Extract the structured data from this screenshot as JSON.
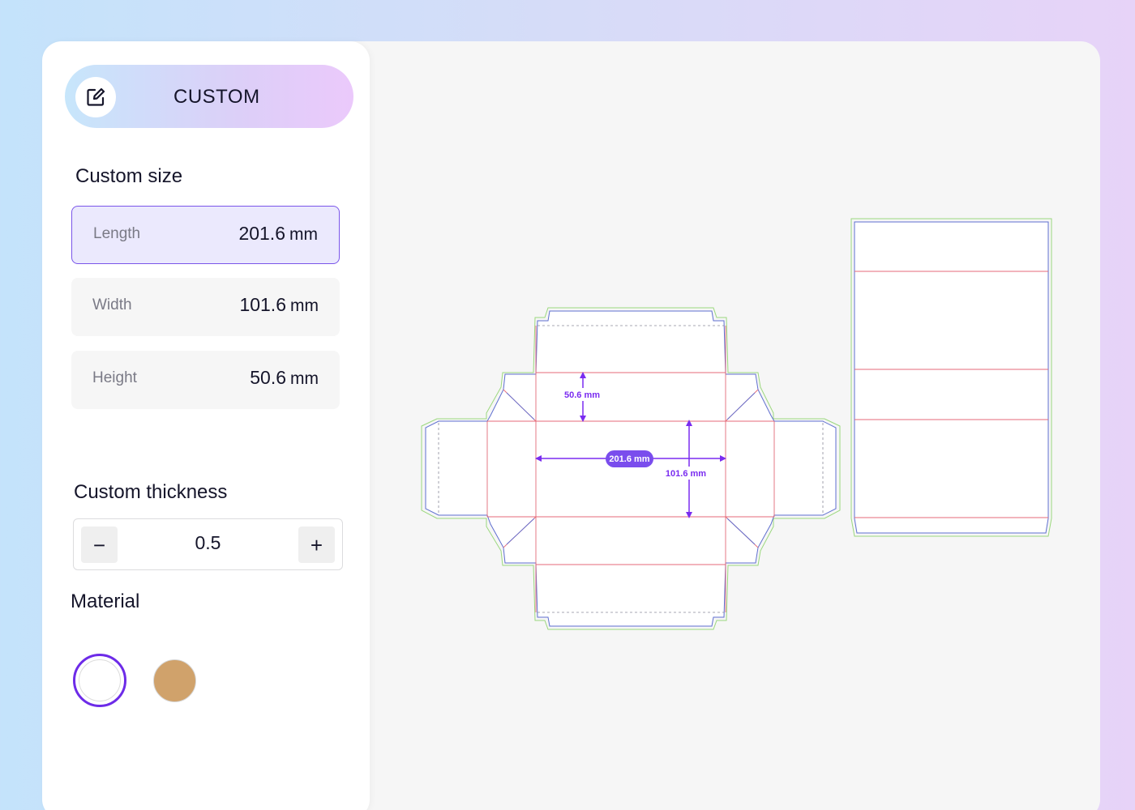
{
  "mode": {
    "label": "CUSTOM",
    "icon": "edit-icon"
  },
  "custom_size": {
    "title": "Custom size",
    "fields": [
      {
        "label": "Length",
        "value": "201.6",
        "unit": "mm",
        "active": true
      },
      {
        "label": "Width",
        "value": "101.6",
        "unit": "mm",
        "active": false
      },
      {
        "label": "Height",
        "value": "50.6",
        "unit": "mm",
        "active": false
      }
    ]
  },
  "custom_thickness": {
    "title": "Custom thickness",
    "value": "0.5",
    "decrement_label": "−",
    "increment_label": "+"
  },
  "material": {
    "title": "Material",
    "options": [
      {
        "name": "white",
        "color": "#ffffff",
        "selected": true
      },
      {
        "name": "kraft",
        "color": "#d0a26b",
        "selected": false
      }
    ]
  },
  "dieline": {
    "length_label": "201.6 mm",
    "width_label": "101.6 mm",
    "height_label": "50.6 mm",
    "colors": {
      "cut": "#5f6fd0",
      "fold": "#e46a78",
      "bleed": "#9bd87d",
      "dimension": "#7a2cf0"
    }
  }
}
